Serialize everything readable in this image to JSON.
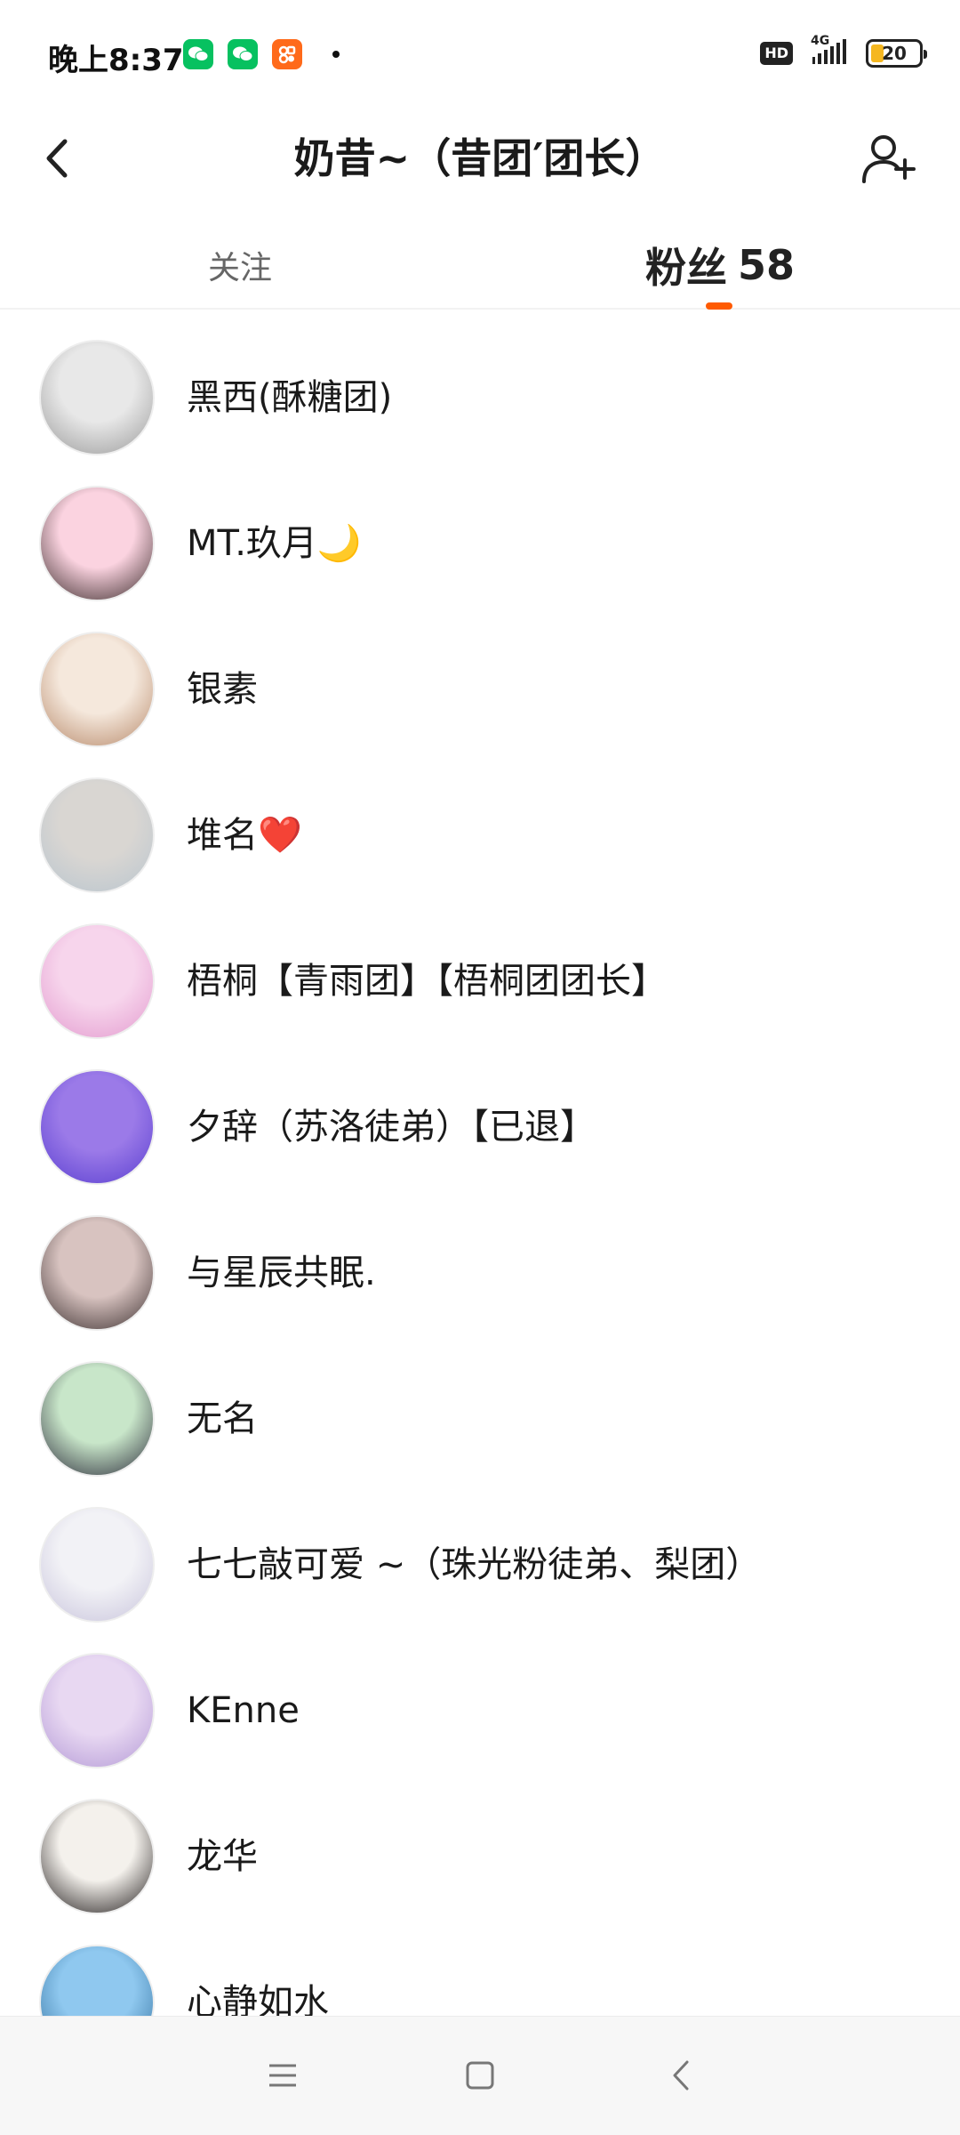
{
  "status_bar": {
    "time": "晚上8:37",
    "notifications": [
      {
        "icon": "wechat-icon",
        "color": "#07c160"
      },
      {
        "icon": "wechat-icon",
        "color": "#07c160"
      },
      {
        "icon": "app-icon",
        "color": "#ff6a1a"
      }
    ],
    "hd": "HD",
    "network": "4G",
    "battery": "20"
  },
  "header": {
    "title": "奶昔~（昔团′团长）"
  },
  "tabs": {
    "follow_label": "关注",
    "fans_label": "粉丝",
    "fans_count": "58"
  },
  "fans": [
    {
      "name": "黑西(酥糖团)",
      "avatar_colors": [
        "#e8e8e8",
        "#9a9a9a"
      ]
    },
    {
      "name": "MT.玖月🌙",
      "avatar_colors": [
        "#fbd3e0",
        "#3a2a2a"
      ]
    },
    {
      "name": "银素",
      "avatar_colors": [
        "#f5e8dc",
        "#b7896a"
      ]
    },
    {
      "name": "堆名❤️",
      "avatar_colors": [
        "#d9d6d2",
        "#b9c5cf"
      ]
    },
    {
      "name": "梧桐【青雨团】【梧桐团团长】",
      "avatar_colors": [
        "#f7d5ec",
        "#e39bcf"
      ]
    },
    {
      "name": "夕辞（苏洛徒弟）【已退】",
      "avatar_colors": [
        "#9b7ae8",
        "#5a3fd0"
      ]
    },
    {
      "name": "与星辰共眠.",
      "avatar_colors": [
        "#d8c3c0",
        "#3b2f2f"
      ]
    },
    {
      "name": "无名",
      "avatar_colors": [
        "#c8e6c9",
        "#2b2b3a"
      ]
    },
    {
      "name": "七七敲可爱 ~（珠光粉徒弟、梨团）",
      "avatar_colors": [
        "#f2f2f6",
        "#c8c4dc"
      ]
    },
    {
      "name": "KEnne",
      "avatar_colors": [
        "#e8d8f2",
        "#b49ad6"
      ]
    },
    {
      "name": "龙华",
      "avatar_colors": [
        "#f4f1ec",
        "#1f1a1a"
      ]
    },
    {
      "name": "心静如水",
      "avatar_colors": [
        "#8fc8ef",
        "#2c6b9a"
      ]
    }
  ],
  "bottom_nav": {
    "menu_icon": "menu-icon",
    "home_icon": "home-icon",
    "back_icon": "back-icon"
  }
}
